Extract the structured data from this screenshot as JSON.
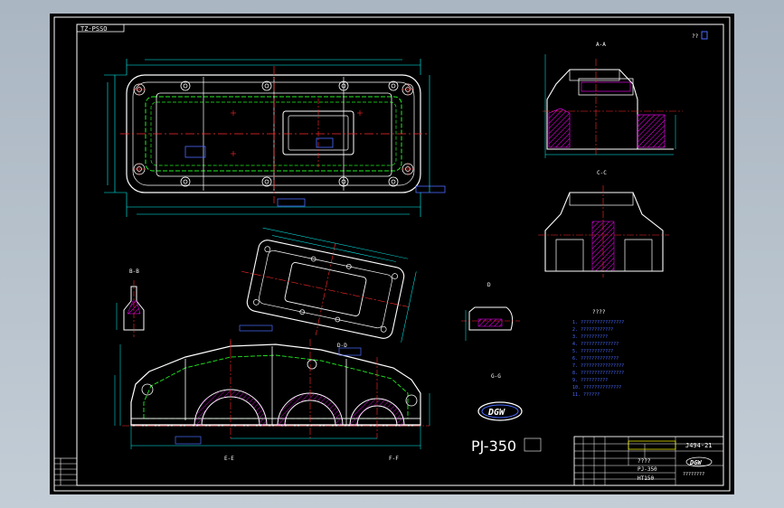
{
  "sheet": {
    "top_tag": "TZ-PSSO",
    "corner_mark": "??",
    "view_labels": {
      "section_aa": "A-A",
      "section_cc": "C-C",
      "section_bb": "B-B",
      "detail_d": "D",
      "section_dd": "D-D",
      "section_ee": "E-E",
      "section_ff": "F-F",
      "section_gg": "G-G"
    },
    "notes_title": "????",
    "notes": [
      "1. ????????????????",
      "2. ????????????",
      "3. ??????????",
      "4. ??????????????",
      "5. ????????????",
      "6. ??????????????",
      "7. ????????????????",
      "8. ????????????????",
      "9. ??????????",
      "10. ??????????????",
      "11. ??????"
    ],
    "logo_text": "DGW",
    "model_text": "PJ-350",
    "scale_label": "??",
    "title_block": {
      "drawing_no": "J494-21",
      "name": "????",
      "model": "PJ-350",
      "material": "HT150",
      "company_logo": "DGW",
      "company": "????????"
    },
    "colors": {
      "outline": "#ffffff",
      "dimension": "#00ffff",
      "center": "#ff2a2a",
      "hidden": "#22ee22",
      "hatch": "#ff00ff",
      "text_blue": "#4a6bff",
      "yellow": "#ffff00"
    }
  }
}
